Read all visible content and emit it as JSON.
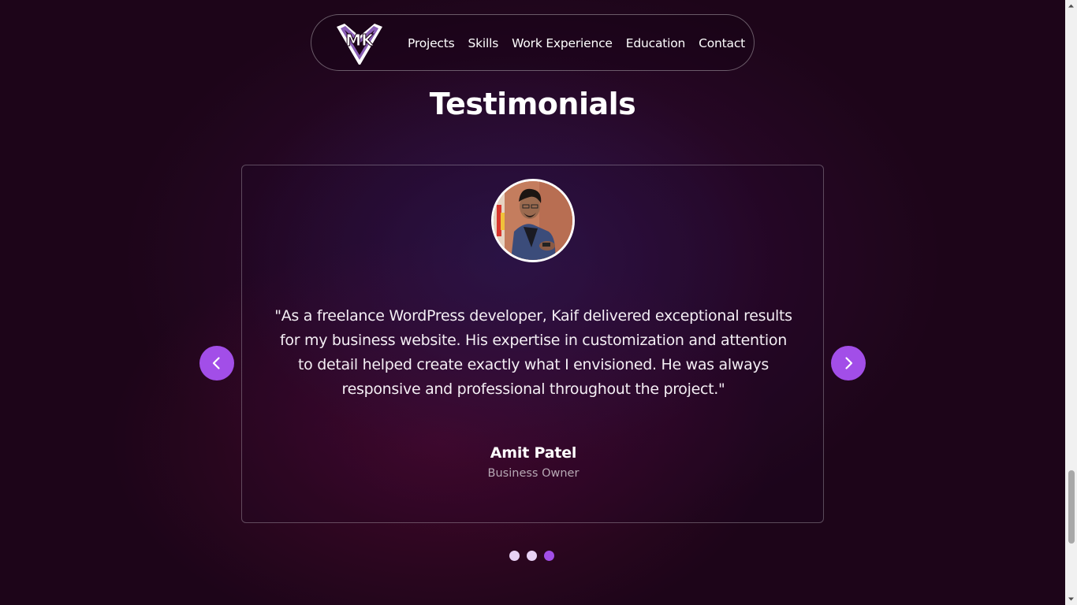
{
  "nav": {
    "logo_text": "MK",
    "links": [
      "Projects",
      "Skills",
      "Work Experience",
      "Education",
      "Contact"
    ]
  },
  "section": {
    "title": "Testimonials"
  },
  "testimonial": {
    "quote": "\"As a freelance WordPress developer, Kaif delivered exceptional results for my business website. His expertise in customization and attention to detail helped create exactly what I envisioned. He was always responsive and professional throughout the project.\"",
    "name": "Amit Patel",
    "role": "Business Owner"
  },
  "carousel": {
    "slide_count": 3,
    "active_index": 2
  },
  "colors": {
    "background": "#1d0519",
    "accent": "#a24ee8",
    "dot_inactive": "#e8d2f5",
    "role_text": "#b7a9b5"
  },
  "icons": {
    "prev": "chevron-left-icon",
    "next": "chevron-right-icon",
    "scroll_up": "caret-up-icon",
    "scroll_down": "caret-down-icon"
  }
}
